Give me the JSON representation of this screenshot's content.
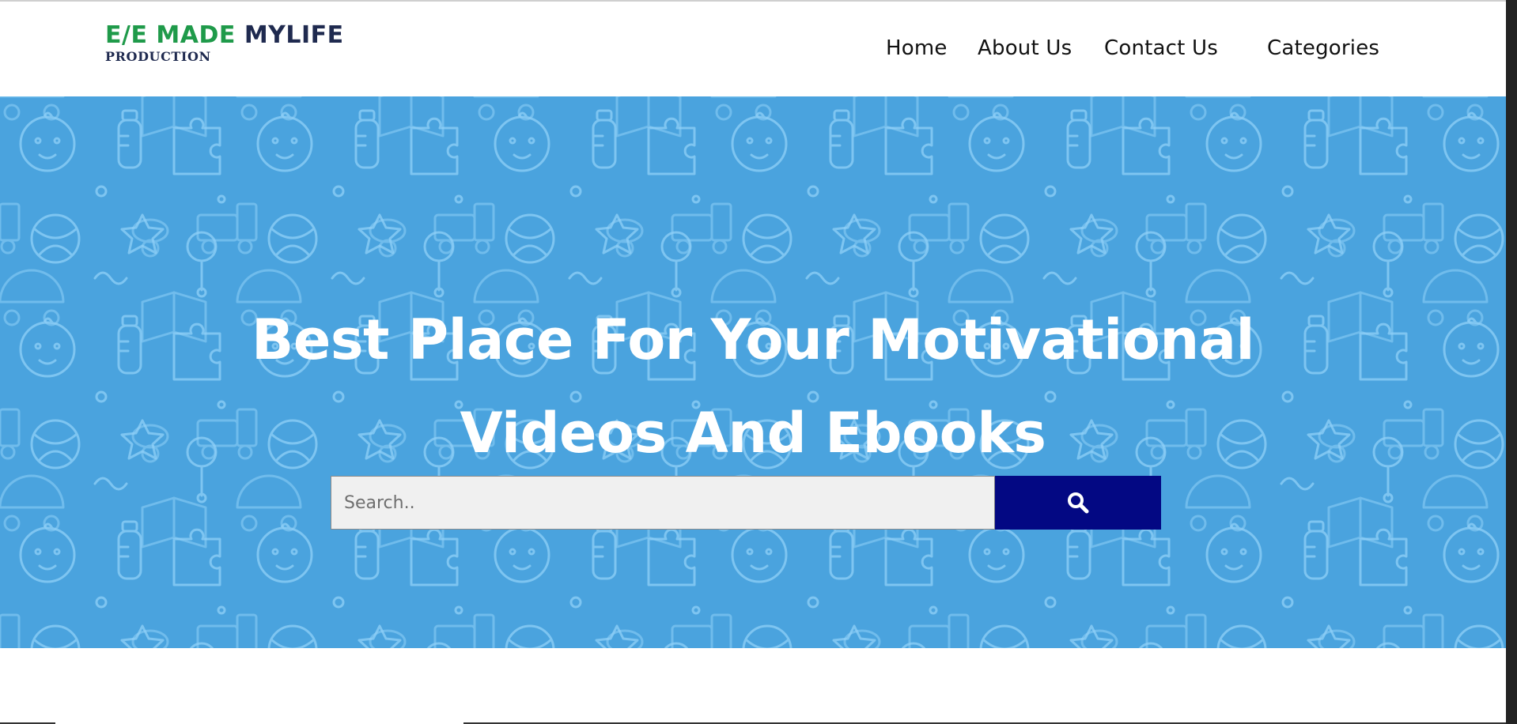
{
  "logo": {
    "part_green": "E/E MADE",
    "part_navy": "MYLIFE",
    "subtitle": "PRODUCTION"
  },
  "nav": {
    "items": [
      {
        "label": "Home"
      },
      {
        "label": "About Us"
      },
      {
        "label": "Contact Us"
      },
      {
        "label": "Categories"
      }
    ]
  },
  "hero": {
    "title_line1": "Best Place For Your Motivational",
    "title_line2": "Videos And Ebooks",
    "background_color": "#4aa3de",
    "pattern_icons": [
      "baby-bottle-icon",
      "baby-face-icon",
      "puzzle-piece-icon",
      "rattle-icon",
      "pacifier-icon",
      "tricycle-icon",
      "book-icon",
      "diaper-icon",
      "toy-train-icon",
      "rocking-horse-icon",
      "stroller-icon",
      "ball-icon",
      "star-icon",
      "bib-icon",
      "apple-icon"
    ]
  },
  "search": {
    "placeholder": "Search..",
    "value": "",
    "button_icon": "search-icon",
    "button_color": "#030883"
  },
  "colors": {
    "logo_green": "#1f9a4a",
    "logo_navy": "#1f2a4f",
    "hero_blue": "#4aa3de",
    "search_button": "#030883"
  }
}
